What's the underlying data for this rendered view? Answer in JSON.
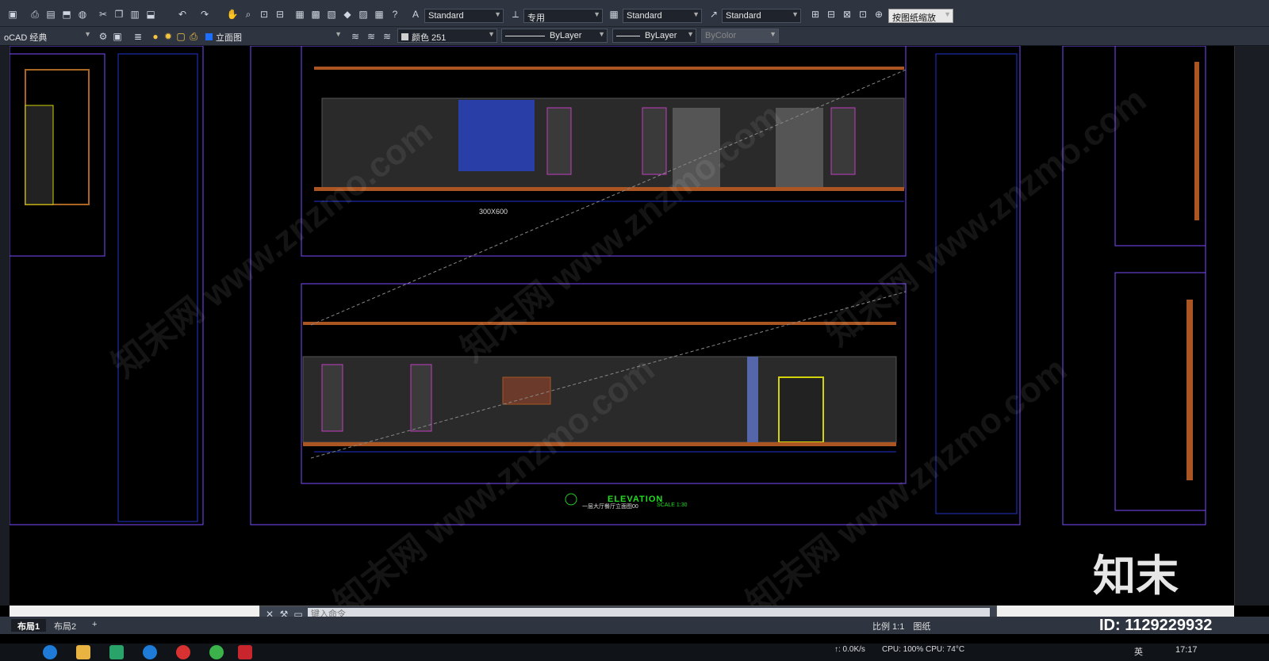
{
  "toolbar1": {
    "text_style": "Standard",
    "dim_style": "专用",
    "table_style": "Standard",
    "multileader_style": "Standard",
    "viewport_scale": "按图纸缩放"
  },
  "toolbar2": {
    "workspace": "oCAD 经典",
    "layer": "立面图",
    "color": "颜色 251",
    "linetype": "ByLayer",
    "lineweight": "ByLayer",
    "plotstyle": "ByColor"
  },
  "drawing": {
    "tile_size_label": "300X600",
    "elevation_title": "ELEVATION",
    "elevation_sub": "一层大厅餐厅立面图00",
    "scale_label": "SCALE 1:30"
  },
  "command": {
    "placeholder": "键入命令"
  },
  "tabs": [
    "布局1",
    "布局2"
  ],
  "status": {
    "scale": "比例 1:1",
    "paper": "图纸",
    "id_text": "ID: 1129229932",
    "net": "↑: 0.0K/s",
    "cpu": "CPU: 100% CPU: 74°C",
    "ime": "英",
    "time": "17:17"
  },
  "watermark": "知末网 www.znzmo.com",
  "logo": "知末"
}
